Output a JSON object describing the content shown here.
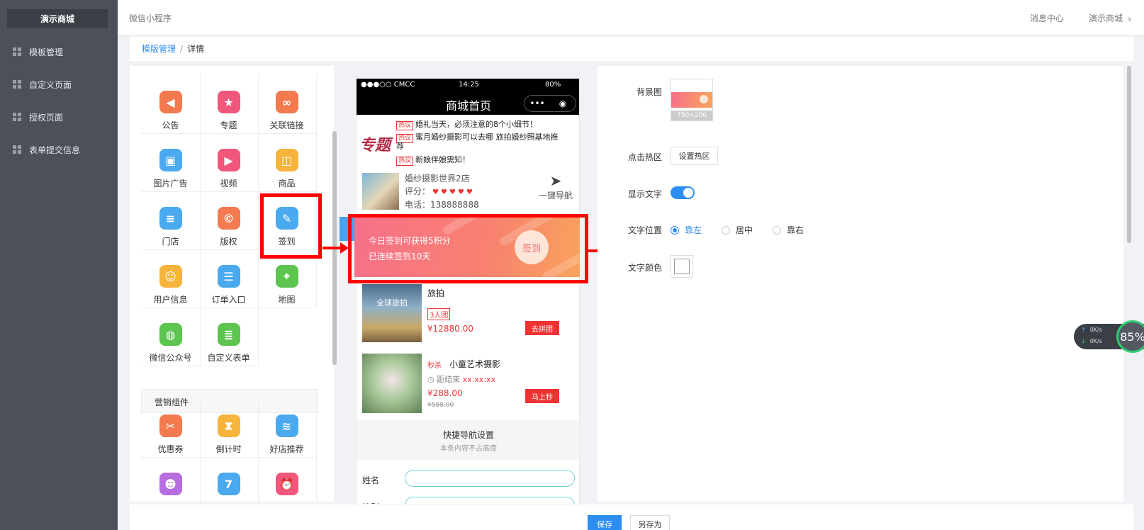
{
  "sidebar": {
    "brand": "演示商城",
    "items": [
      {
        "label": "模板管理"
      },
      {
        "label": "自定义页面"
      },
      {
        "label": "授权页面"
      },
      {
        "label": "表单提交信息"
      }
    ]
  },
  "topbar": {
    "title": "微信小程序",
    "message_center": "消息中心",
    "shop_menu": "演示商城"
  },
  "breadcrumb": {
    "link": "模版管理",
    "sep": "/",
    "current": "详情"
  },
  "components": {
    "basic": [
      {
        "label": "公告",
        "icon": "megaphone-icon",
        "color": "#f37a4f"
      },
      {
        "label": "专题",
        "icon": "shield-star-icon",
        "color": "#f0577a"
      },
      {
        "label": "关联链接",
        "icon": "link-icon",
        "color": "#f37a4f"
      },
      {
        "label": "图片广告",
        "icon": "image-icon",
        "color": "#4aa9ef"
      },
      {
        "label": "视频",
        "icon": "video-icon",
        "color": "#f0577a"
      },
      {
        "label": "商品",
        "icon": "bag-icon",
        "color": "#f7b43c"
      },
      {
        "label": "门店",
        "icon": "store-icon",
        "color": "#4aa9ef"
      },
      {
        "label": "版权",
        "icon": "copyright-icon",
        "color": "#f37a4f"
      },
      {
        "label": "签到",
        "icon": "pencil-icon",
        "color": "#4aa9ef"
      },
      {
        "label": "用户信息",
        "icon": "user-card-icon",
        "color": "#f7b43c"
      },
      {
        "label": "订单入口",
        "icon": "clipboard-icon",
        "color": "#4aa9ef"
      },
      {
        "label": "地图",
        "icon": "map-pin-icon",
        "color": "#5cc44f"
      },
      {
        "label": "微信公众号",
        "icon": "wechat-icon",
        "color": "#5cc44f"
      },
      {
        "label": "自定义表单",
        "icon": "form-icon",
        "color": "#5cc44f"
      }
    ],
    "marketing_title": "营销组件",
    "marketing": [
      {
        "label": "优惠券",
        "icon": "coupon-icon",
        "color": "#f37a4f"
      },
      {
        "label": "倒计时",
        "icon": "hourglass-icon",
        "color": "#f7b43c"
      },
      {
        "label": "好店推荐",
        "icon": "shop-recommend-icon",
        "color": "#4aa9ef"
      },
      {
        "label": "",
        "icon": "group-icon",
        "color": "#b66de0"
      },
      {
        "label": "",
        "icon": "calendar-icon",
        "color": "#4aa9ef"
      },
      {
        "label": "",
        "icon": "alarm-clock-icon",
        "color": "#f0577a"
      }
    ]
  },
  "phone": {
    "carrier": "●●●○○ CMCC",
    "time": "14:25",
    "battery": "80%",
    "page_title": "商城首页",
    "capsule_more": "•••",
    "news_logo": "专题",
    "hot_tag": "热议",
    "news": [
      "婚礼当天，必须注意的8个小细节！",
      "蜜月婚纱摄影可以去哪 旅拍婚纱照基地推",
      "荐",
      "新娘伴娘需知！"
    ],
    "store": {
      "name": "婚纱摄影世界2店",
      "rating_label": "评分：",
      "hearts": "♥♥♥♥♥",
      "tel": "电话：138888888",
      "nav_label": "一键导航"
    },
    "signin": {
      "line1": "今日签到可获得5积分",
      "line2": "已连续签到10天",
      "button": "签到"
    },
    "group": {
      "thumb_text": "全球旅拍",
      "name": "旅拍",
      "tag": "3人团",
      "price": "¥12880.00",
      "button": "去拼团"
    },
    "flash": {
      "tag": "秒杀",
      "name": "小童艺术摄影",
      "end_label": "距结束",
      "end_time": "xx:xx:xx",
      "price": "¥288.00",
      "old_price": "¥588.00",
      "button": "马上秒"
    },
    "quicknav": {
      "title": "快捷导航设置",
      "subtitle": "本条内容不占高度"
    },
    "form": {
      "name_label": "姓名",
      "second_label": "性别"
    }
  },
  "settings": {
    "bg_label": "背景图",
    "bg_size": "750×200",
    "hotspot_label": "点击热区",
    "hotspot_button": "设置热区",
    "show_text_label": "显示文字",
    "show_text_on": true,
    "position_label": "文字位置",
    "positions": [
      "靠左",
      "居中",
      "靠右"
    ],
    "position_selected": "靠左",
    "color_label": "文字颜色",
    "text_color": "#ffffff"
  },
  "netmon": {
    "up": "0K/s",
    "down": "0K/s",
    "percent": "85%"
  },
  "footer": {
    "save": "保存",
    "save_as": "另存为"
  },
  "colors": {
    "accent": "#2d8cf0",
    "highlight": "#ff0000",
    "sidebar": "#4b5059"
  }
}
